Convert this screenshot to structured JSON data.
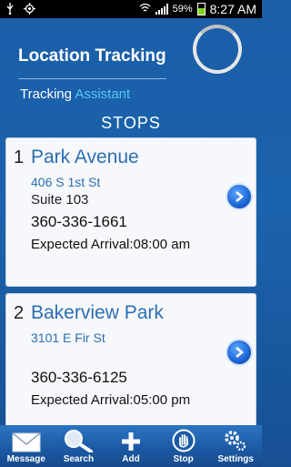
{
  "status_bar": {
    "battery": "59%",
    "time": "8:27 AM"
  },
  "header": {
    "title": "Location Tracking",
    "subtitle_prefix": "Tracking",
    "subtitle_accent": "Assistant",
    "section_title": "STOPS"
  },
  "stops": [
    {
      "number": "1",
      "name": "Park Avenue",
      "address": "406 S 1st St",
      "suite": "Suite 103",
      "phone": "360-336-1661",
      "eta": "Expected Arrival:08:00 am"
    },
    {
      "number": "2",
      "name": "Bakerview Park",
      "address": "3101 E Fir St",
      "suite": "",
      "phone": "360-336-6125",
      "eta": "Expected Arrival:05:00 pm"
    }
  ],
  "toolbar": {
    "message": "Message",
    "search": "Search",
    "add": "Add",
    "stop": "Stop",
    "settings": "Settings"
  },
  "colors": {
    "accent": "#55c8f4",
    "header_bg": "#1b63ac",
    "link_blue": "#2a6fb3"
  }
}
